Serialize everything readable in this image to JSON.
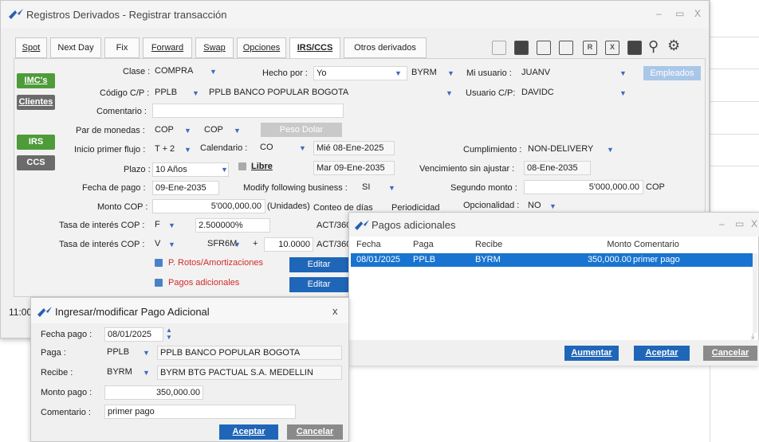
{
  "main": {
    "title": "Registros Derivados - Registrar transacción",
    "tabs": [
      "Spot",
      "Next Day",
      "Fix",
      "Forward",
      "Swap",
      "Opciones",
      "IRS/CCS",
      "Otros derivados"
    ],
    "side_buttons": {
      "imcs": "IMC's",
      "clientes": "Clientes",
      "irs": "IRS",
      "ccs": "CCS"
    },
    "clase": {
      "label": "Clase :",
      "value": "COMPRA"
    },
    "hecho_por": {
      "label": "Hecho por :",
      "value": "Yo",
      "code": "BYRM"
    },
    "mi_usuario": {
      "label": "Mi usuario :",
      "value": "JUANV"
    },
    "empleados": "Empleados",
    "codigo_cp": {
      "label": "Código C/P :",
      "code": "PPLB",
      "name": "PPLB BANCO POPULAR BOGOTA"
    },
    "usuario_cp": {
      "label": "Usuario C/P:",
      "value": "DAVIDC"
    },
    "comentario": {
      "label": "Comentario :",
      "value": ""
    },
    "par_monedas": {
      "label": "Par de monedas :",
      "a": "COP",
      "b": "COP",
      "peso_dolar": "Peso Dolar"
    },
    "inicio_flujo": {
      "label": "Inicio primer flujo :",
      "value": "T + 2"
    },
    "calendario": {
      "label": "Calendario :",
      "value": "CO",
      "date": "Mié 08-Ene-2025"
    },
    "cumplimiento": {
      "label": "Cumplimiento :",
      "value": "NON-DELIVERY"
    },
    "plazo": {
      "label": "Plazo :",
      "value": "10 Años",
      "libre": "Libre",
      "date": "Mar 09-Ene-2035"
    },
    "vencimiento": {
      "label": "Vencimiento sin ajustar :",
      "value": "08-Ene-2035"
    },
    "fecha_pago": {
      "label": "Fecha de pago :",
      "value": "09-Ene-2035"
    },
    "modify": {
      "label": "Modify following business :",
      "value": "SI"
    },
    "segundo_monto": {
      "label": "Segundo monto :",
      "value": "5'000,000.00",
      "ccy": "COP"
    },
    "monto_cop": {
      "label": "Monto COP :",
      "value": "5'000,000.00",
      "unit": "(Unidades)",
      "conteo": "Conteo de días",
      "periodicidad": "Periodicidad"
    },
    "opcionalidad": {
      "label": "Opcionalidad :",
      "value": "NO"
    },
    "tasa1": {
      "label": "Tasa de interés COP :",
      "type": "F",
      "value": "2.500000%",
      "basis": "ACT/360"
    },
    "tasa2": {
      "label": "Tasa de interés COP :",
      "type": "V",
      "index": "SFR6M",
      "sign": "+",
      "spread": "10.0000",
      "basis": "ACT/360"
    },
    "p_rotos": "P. Rotos/Amortizaciones",
    "pagos_adicionales": "Pagos adicionales",
    "editar": "Editar",
    "time": "11:00"
  },
  "pagos": {
    "title": "Pagos adicionales",
    "columns": [
      "Fecha",
      "Paga",
      "Recibe",
      "Monto",
      "Comentario"
    ],
    "rows": [
      [
        "08/01/2025",
        "PPLB",
        "BYRM",
        "350,000.00",
        "primer pago"
      ]
    ],
    "buttons": {
      "aumentar": "Aumentar",
      "aceptar": "Aceptar",
      "cancelar": "Cancelar"
    }
  },
  "ingresar": {
    "title": "Ingresar/modificar Pago Adicional",
    "fecha": {
      "label": "Fecha pago :",
      "value": "08/01/2025"
    },
    "paga": {
      "label": "Paga :",
      "code": "PPLB",
      "name": "PPLB  BANCO POPULAR  BOGOTA"
    },
    "recibe": {
      "label": "Recibe :",
      "code": "BYRM",
      "name": "BYRM  BTG PACTUAL S.A.  MEDELLIN"
    },
    "monto": {
      "label": "Monto pago :",
      "value": "350,000.00"
    },
    "comentario": {
      "label": "Comentario :",
      "value": "primer pago"
    },
    "aceptar": "Aceptar",
    "cancelar": "Cancelar"
  },
  "colors": {
    "green": "#4e9b3a",
    "blue": "#1f66b8",
    "red": "#d22b2b",
    "selected": "#1874d0"
  }
}
